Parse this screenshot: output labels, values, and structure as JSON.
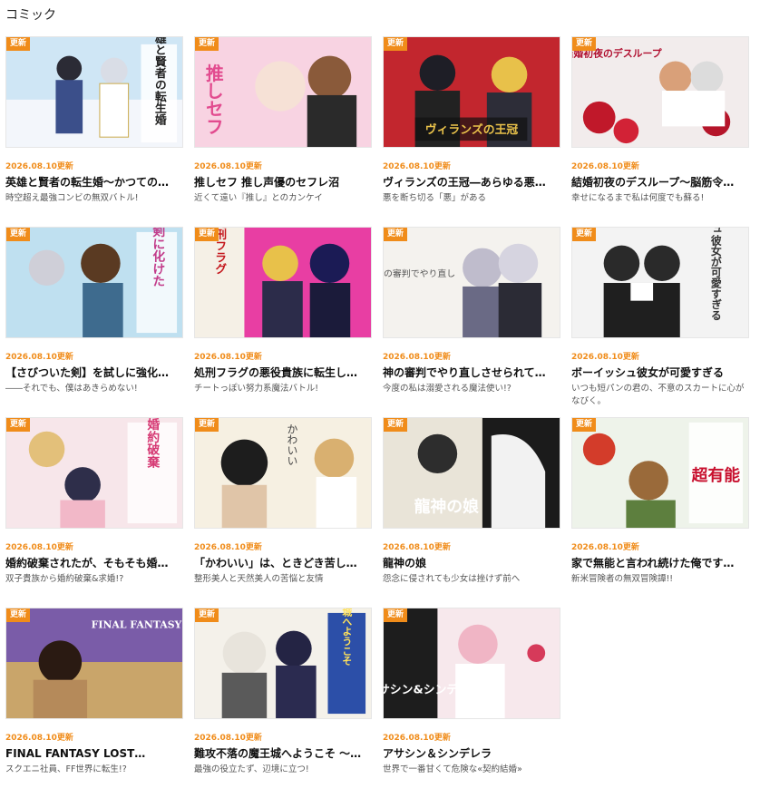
{
  "section": {
    "title": "コミック"
  },
  "badge_label": "更新",
  "colors": {
    "accent": "#f08c1a"
  },
  "items": [
    {
      "date": "2026.08.10更新",
      "title": "英雄と賢者の転生婚～かつての…",
      "sub": "時空超え最強コンビの無双バトル!",
      "art_text": "英雄と賢者の転生婚"
    },
    {
      "date": "2026.08.10更新",
      "title": "推しセフ 推し声優のセフレ沼",
      "sub": "近くて遠い『推し』とのカンケイ",
      "art_text": "推しセフ"
    },
    {
      "date": "2026.08.10更新",
      "title": "ヴィランズの王冠―あらゆる悪…",
      "sub": "悪を断ち切る「悪」がある",
      "art_text": "ヴィランズの王冠"
    },
    {
      "date": "2026.08.10更新",
      "title": "結婚初夜のデスループ～脳筋令…",
      "sub": "幸せになるまで私は何度でも蘇る!",
      "art_text": "結婚初夜のデスループ"
    },
    {
      "date": "2026.08.10更新",
      "title": "【さびついた剣】を試しに強化…",
      "sub": "――それでも、僕はあきらめない!",
      "art_text": "魔剣に化けた"
    },
    {
      "date": "2026.08.10更新",
      "title": "処刑フラグの悪役貴族に転生し…",
      "sub": "チートっぽい努力系魔法バトル!",
      "art_text": "処刑フラグ"
    },
    {
      "date": "2026.08.10更新",
      "title": "神の審判でやり直しさせられて…",
      "sub": "今度の私は溺愛される魔法使い!?",
      "art_text": "神の審判でやり直し"
    },
    {
      "date": "2026.08.10更新",
      "title": "ボーイッシュ彼女が可愛すぎる",
      "sub": "いつも短パンの君の、不意のスカートに心がなびく。",
      "art_text": "ボーイッシュ彼女が可愛すぎる"
    },
    {
      "date": "2026.08.10更新",
      "title": "婚約破棄されたが、そもそも婚…",
      "sub": "双子貴族から婚約破棄&求婚!?",
      "art_text": "婚約破棄"
    },
    {
      "date": "2026.08.10更新",
      "title": "「かわいい」は、ときどき苦し…",
      "sub": "整形美人と天然美人の苦悩と友情",
      "art_text": "かわいい"
    },
    {
      "date": "2026.08.10更新",
      "title": "龍神の娘",
      "sub": "怨念に侵されても少女は挫けず前へ",
      "art_text": "龍神の娘"
    },
    {
      "date": "2026.08.10更新",
      "title": "家で無能と言われ続けた俺です…",
      "sub": "新米冒険者の無双冒険譚!!",
      "art_text": "超有能"
    },
    {
      "date": "2026.08.10更新",
      "title": "FINAL FANTASY LOST…",
      "sub": "スクエニ社員、FF世界に転生!?",
      "art_text": "FINAL FANTASY"
    },
    {
      "date": "2026.08.10更新",
      "title": "難攻不落の魔王城へようこそ ～…",
      "sub": "最強の役立たず、辺境に立つ!",
      "art_text": "魔王城へようこそ"
    },
    {
      "date": "2026.08.10更新",
      "title": "アサシン＆シンデレラ",
      "sub": "世界で一番甘くて危険な«契約結婚»",
      "art_text": "アサシン&シンデレラ"
    }
  ]
}
